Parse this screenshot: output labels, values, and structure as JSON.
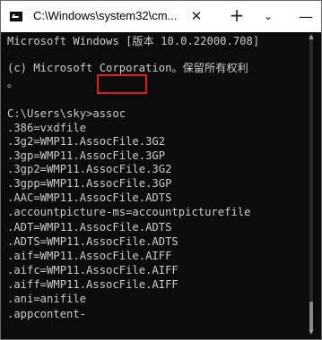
{
  "titlebar": {
    "title": "C:\\Windows\\system32\\cm...",
    "close_tab_glyph": "✕",
    "new_tab_glyph": "+",
    "dropdown_glyph": "⌄",
    "minimize_glyph": "—"
  },
  "console": {
    "lines": [
      "Microsoft Windows [版本 10.0.22000.708]",
      "(c) Microsoft Corporation。保留所有权利",
      "。",
      "",
      "C:\\Users\\sky>assoc",
      ".386=vxdfile",
      ".3g2=WMP11.AssocFile.3G2",
      ".3gp=WMP11.AssocFile.3GP",
      ".3gp2=WMP11.AssocFile.3G2",
      ".3gpp=WMP11.AssocFile.3GP",
      ".AAC=WMP11.AssocFile.ADTS",
      ".accountpicture-ms=accountpicturefile",
      ".ADT=WMP11.AssocFile.ADTS",
      ".ADTS=WMP11.AssocFile.ADTS",
      ".aif=WMP11.AssocFile.AIFF",
      ".aifc=WMP11.AssocFile.AIFF",
      ".aiff=WMP11.AssocFile.AIFF",
      ".ani=anifile",
      ".appcontent-"
    ]
  },
  "colors": {
    "console_bg": "#0c0c0c",
    "console_fg": "#cccccc",
    "highlight": "#e21b1b"
  }
}
